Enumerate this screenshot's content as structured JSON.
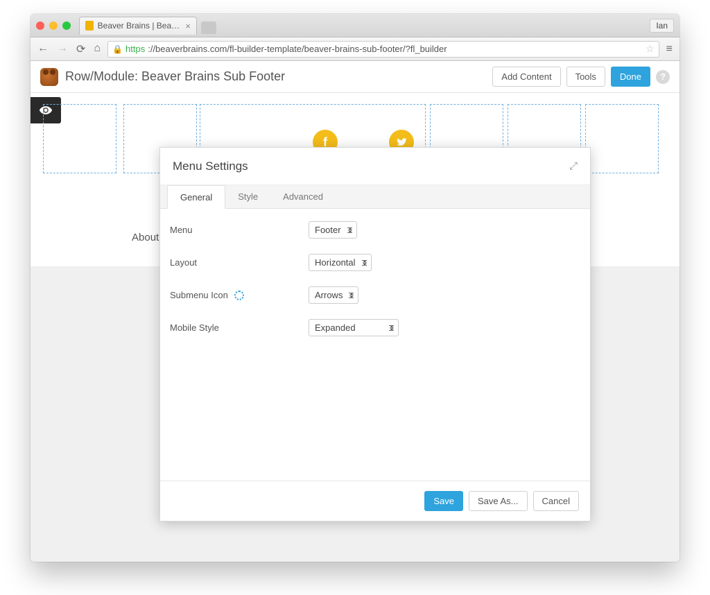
{
  "browser": {
    "tab_title": "Beaver Brains | Beaver Bra",
    "profile_label": "Ian",
    "url_https": "https",
    "url_rest": "://beaverbrains.com/fl-builder-template/beaver-brains-sub-footer/?fl_builder"
  },
  "builder": {
    "title": "Row/Module: Beaver Brains Sub Footer",
    "add_content": "Add Content",
    "tools": "Tools",
    "done": "Done"
  },
  "canvas": {
    "about_label": "About"
  },
  "modal": {
    "title": "Menu Settings",
    "tabs": {
      "general": "General",
      "style": "Style",
      "advanced": "Advanced"
    },
    "fields": {
      "menu_label": "Menu",
      "menu_value": "Footer",
      "layout_label": "Layout",
      "layout_value": "Horizontal",
      "submenu_icon_label": "Submenu Icon",
      "submenu_icon_value": "Arrows",
      "mobile_style_label": "Mobile Style",
      "mobile_style_value": "Expanded"
    },
    "footer": {
      "save": "Save",
      "save_as": "Save As...",
      "cancel": "Cancel"
    }
  }
}
